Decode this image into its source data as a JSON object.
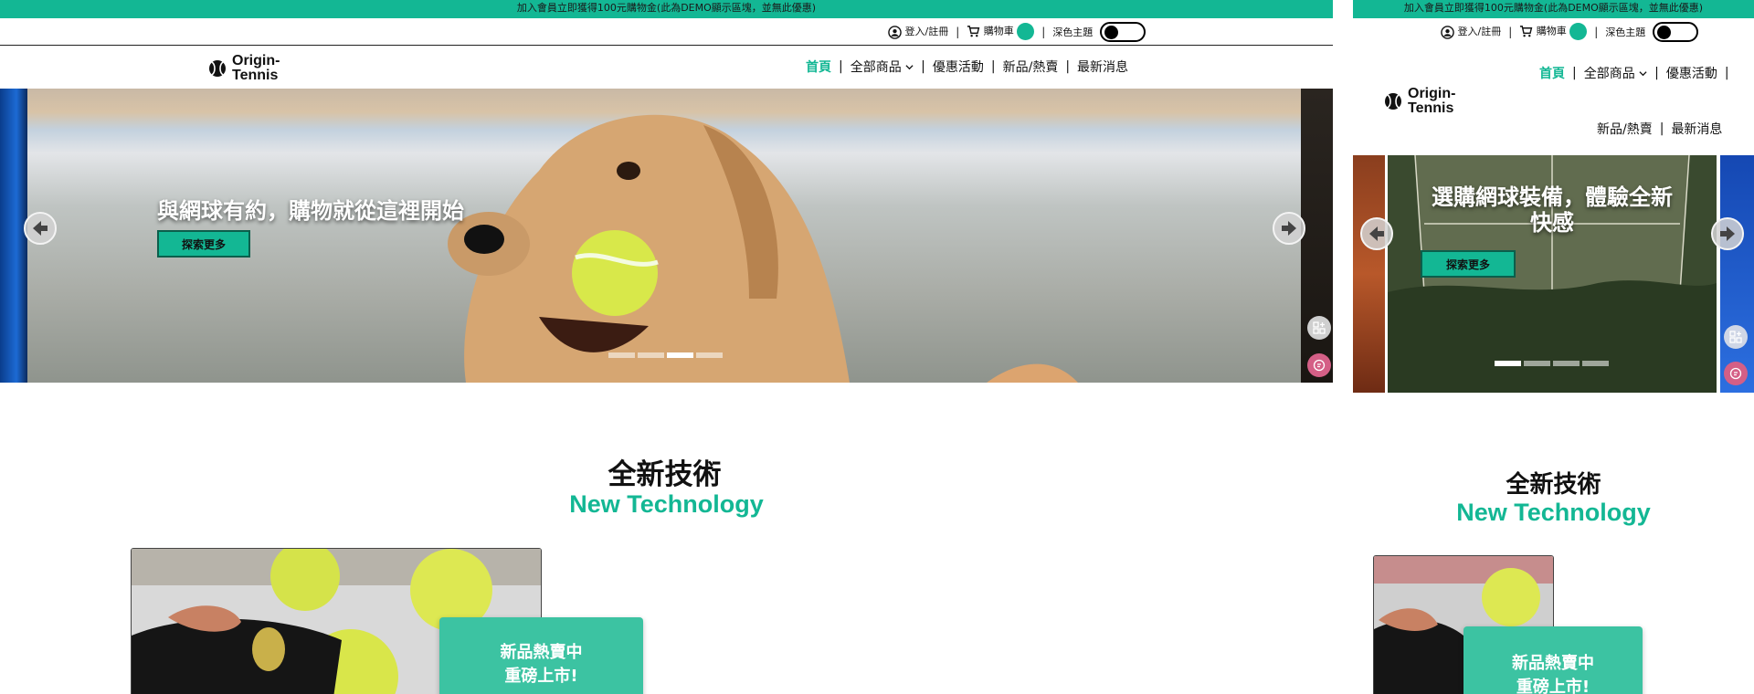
{
  "banner": {
    "text": "加入會員立即獲得100元購物金(此為DEMO顯示區塊，並無此優惠)"
  },
  "util": {
    "login_label": "登入/註冊",
    "cart_label": "購物車",
    "theme_label": "深色主題",
    "separator": "|"
  },
  "logo": {
    "line1": "Origin-",
    "line2": "Tennis"
  },
  "nav": {
    "items": [
      "首頁",
      "全部商品",
      "優惠活動",
      "新品/熱賣",
      "最新消息"
    ],
    "active_index": 0,
    "separator": "|",
    "dropdown_index": 1
  },
  "hero_desktop": {
    "title": "與網球有約，購物就從這裡開始",
    "cta_label": "探索更多",
    "slide_count": 4,
    "active_dot": 2
  },
  "hero_mobile": {
    "title_line1": "選購網球裝備，體驗全新",
    "title_line2": "快感",
    "cta_label": "探索更多",
    "slide_count": 4,
    "active_dot": 0
  },
  "section": {
    "title_zh": "全新技術",
    "title_en": "New Technology"
  },
  "promo": {
    "line1": "新品熱賣中",
    "line2": "重磅上市!"
  },
  "colors": {
    "accent": "#13b794",
    "promo": "#3cc3a2"
  },
  "icons": [
    "user-icon",
    "cart-icon",
    "chevron-down-icon",
    "arrow-left-icon",
    "arrow-right-icon",
    "grid-add-icon",
    "chat-icon",
    "tennis-ball-logo-icon"
  ]
}
